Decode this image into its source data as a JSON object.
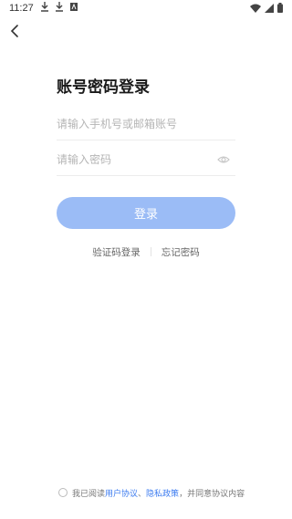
{
  "status_bar": {
    "time": "11:27",
    "left_icons": [
      "download-icon",
      "download-icon",
      "app-notification-icon"
    ],
    "right_icons": [
      "wifi-icon",
      "signal-icon",
      "battery-icon"
    ]
  },
  "nav": {
    "back_icon": "chevron-left-icon"
  },
  "title": "账号密码登录",
  "form": {
    "account_placeholder": "请输入手机号或邮箱账号",
    "account_value": "",
    "password_placeholder": "请输入密码",
    "password_value": "",
    "password_toggle_icon": "eye-icon"
  },
  "login_button": "登录",
  "links": {
    "verification_login": "验证码登录",
    "forgot_password": "忘记密码"
  },
  "agreement": {
    "prefix": "我已阅读",
    "user_agreement": "用户协议",
    "separator": "、",
    "privacy_policy": "隐私政策",
    "suffix": "，并同意协议内容",
    "checked": false
  },
  "colors": {
    "accent": "#9bbcf6",
    "link": "#3d7cf0",
    "placeholder": "#b5b5b5"
  }
}
